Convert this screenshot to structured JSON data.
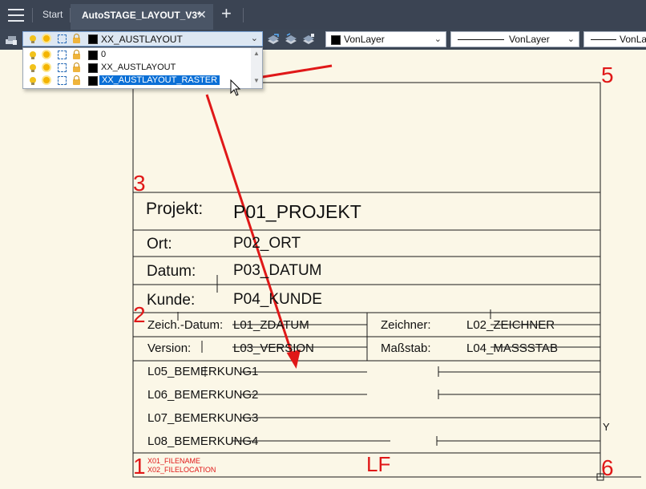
{
  "tabs": {
    "start_label": "Start",
    "active_label": "AutoSTAGE_LAYOUT_V3*",
    "close_glyph": "✕",
    "add_glyph": "+"
  },
  "toolbar": {
    "layer_current": "XX_AUSTLAYOUT",
    "color_value": "VonLayer",
    "linetype_value": "VonLayer",
    "lineweight_value": "VonLa",
    "dropdown_arrow": "⌄"
  },
  "layer_dropdown": {
    "items": [
      {
        "name": "0"
      },
      {
        "name": "XX_AUSTLAYOUT"
      },
      {
        "name": "XX_AUSTLAYOUT_RASTER"
      }
    ],
    "highlighted": "XX_AUSTLAYOUT_RASTER"
  },
  "title_block": {
    "projekt_label": "Projekt:",
    "projekt_value": "P01_PROJEKT",
    "ort_label": "Ort:",
    "ort_value": "P02_ORT",
    "datum_label": "Datum:",
    "datum_value": "P03_DATUM",
    "kunde_label": "Kunde:",
    "kunde_value": "P04_KUNDE",
    "zeichdatum_label": "Zeich.-Datum:",
    "zeichdatum_value": "L01_ZDATUM",
    "zeichner_label": "Zeichner:",
    "zeichner_value": "L02_ZEICHNER",
    "version_label": "Version:",
    "version_value": "L03_VERSION",
    "massstab_label": "Maßstab:",
    "massstab_value": "L04_MASSSTAB",
    "bemerkung1": "L05_BEMERKUNG1",
    "bemerkung2": "L06_BEMERKUNG2",
    "bemerkung3": "L07_BEMERKUNG3",
    "bemerkung4": "L08_BEMERKUNG4",
    "filename": "X01_FILENAME",
    "filelocation": "X02_FILELOCATION",
    "lf_label": "LF"
  },
  "annotations": {
    "corner_1": "1",
    "corner_2": "2",
    "corner_3": "3",
    "corner_5": "5",
    "corner_6": "6",
    "axis_y": "Y"
  },
  "colors": {
    "tab_bar": "#3b4453",
    "toolbar": "#3c4655",
    "canvas": "#fbf7e7",
    "annotation_red": "#e01818",
    "selection_blue": "#0a6fd6"
  }
}
